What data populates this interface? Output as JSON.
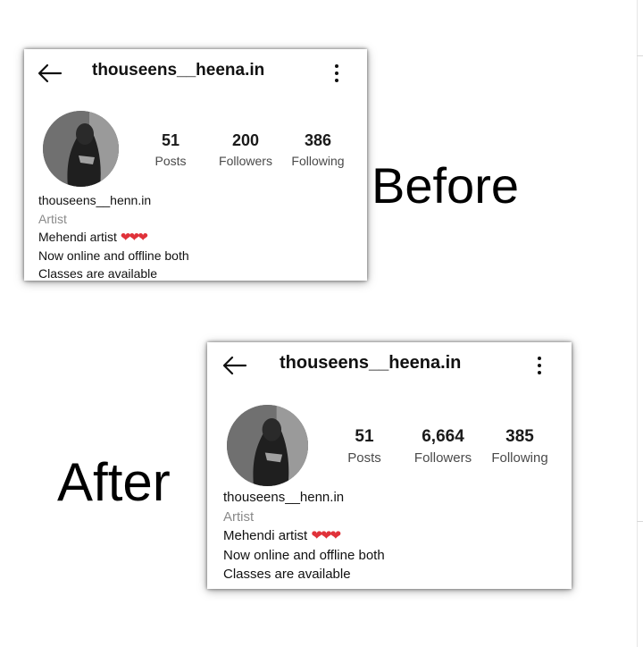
{
  "before": {
    "label": "Before",
    "profile": {
      "username": "thouseens__heena.in",
      "stats": [
        {
          "value": "51",
          "label": "Posts"
        },
        {
          "value": "200",
          "label": "Followers"
        },
        {
          "value": "386",
          "label": "Following"
        }
      ],
      "bio": {
        "name": "thouseens__henn.in",
        "category": "Artist",
        "line1": "Mehendi artist",
        "hearts": "❤❤❤",
        "line2": "Now online and offline both",
        "line3": "Classes are available"
      }
    }
  },
  "after": {
    "label": "After",
    "profile": {
      "username": "thouseens__heena.in",
      "stats": [
        {
          "value": "51",
          "label": "Posts"
        },
        {
          "value": "6,664",
          "label": "Followers"
        },
        {
          "value": "385",
          "label": "Following"
        }
      ],
      "bio": {
        "name": "thouseens__henn.in",
        "category": "Artist",
        "line1": "Mehendi artist",
        "hearts": "❤❤❤",
        "line2": "Now online and offline both",
        "line3": "Classes are available"
      }
    }
  },
  "icons": {
    "back": "back-arrow-icon",
    "more": "more-options-icon",
    "hearts": "red-heart-emoji"
  },
  "colors": {
    "heart": "#e0323a",
    "muted": "#8a8a8a"
  }
}
